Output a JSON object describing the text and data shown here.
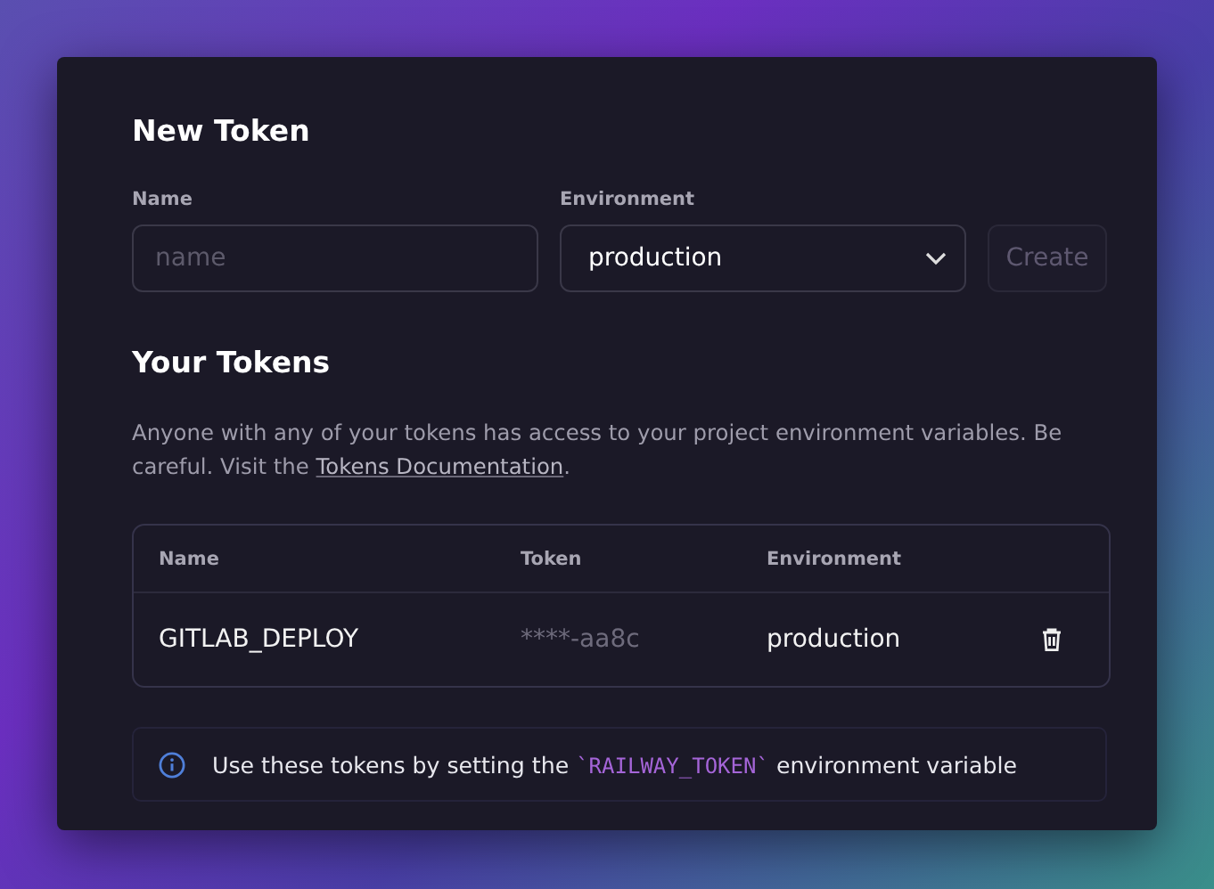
{
  "new_token": {
    "title": "New Token",
    "name_label": "Name",
    "name_placeholder": "name",
    "environment_label": "Environment",
    "environment_value": "production",
    "create_button": {
      "label": "Create",
      "disabled": true
    }
  },
  "your_tokens": {
    "title": "Your Tokens",
    "description_before": "Anyone with any of your tokens has access to your project environment variables. Be careful. Visit the ",
    "description_link": "Tokens Documentation",
    "description_after": ".",
    "table": {
      "columns": [
        "Name",
        "Token",
        "Environment"
      ],
      "rows": [
        {
          "name": "GITLAB_DEPLOY",
          "token": "****-aa8c",
          "environment": "production"
        }
      ]
    }
  },
  "note": {
    "before": "Use these tokens by setting the ",
    "code": "`RAILWAY_TOKEN`",
    "after": " environment variable"
  }
}
